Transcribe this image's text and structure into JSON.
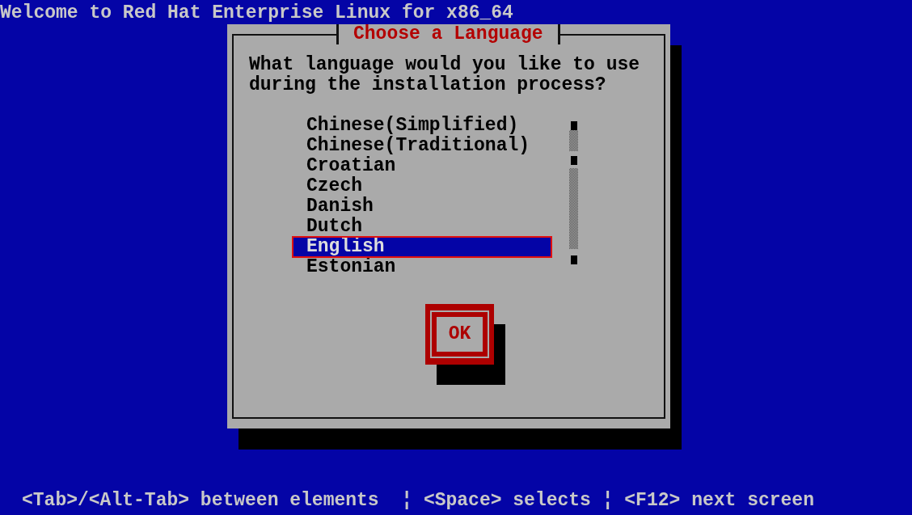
{
  "screen_title": "Welcome to Red Hat Enterprise Linux for x86_64",
  "dialog": {
    "title": "Choose a Language",
    "prompt": "What language would you like to use during the installation process?",
    "languages": [
      {
        "label": "Chinese(Simplified)",
        "selected": false
      },
      {
        "label": "Chinese(Traditional)",
        "selected": false
      },
      {
        "label": "Croatian",
        "selected": false
      },
      {
        "label": "Czech",
        "selected": false
      },
      {
        "label": "Danish",
        "selected": false
      },
      {
        "label": "Dutch",
        "selected": false
      },
      {
        "label": "English",
        "selected": true
      },
      {
        "label": "Estonian",
        "selected": false
      }
    ],
    "button": "OK"
  },
  "help_bar": "<Tab>/<Alt-Tab> between elements  ¦ <Space> selects ¦ <F12> next screen"
}
